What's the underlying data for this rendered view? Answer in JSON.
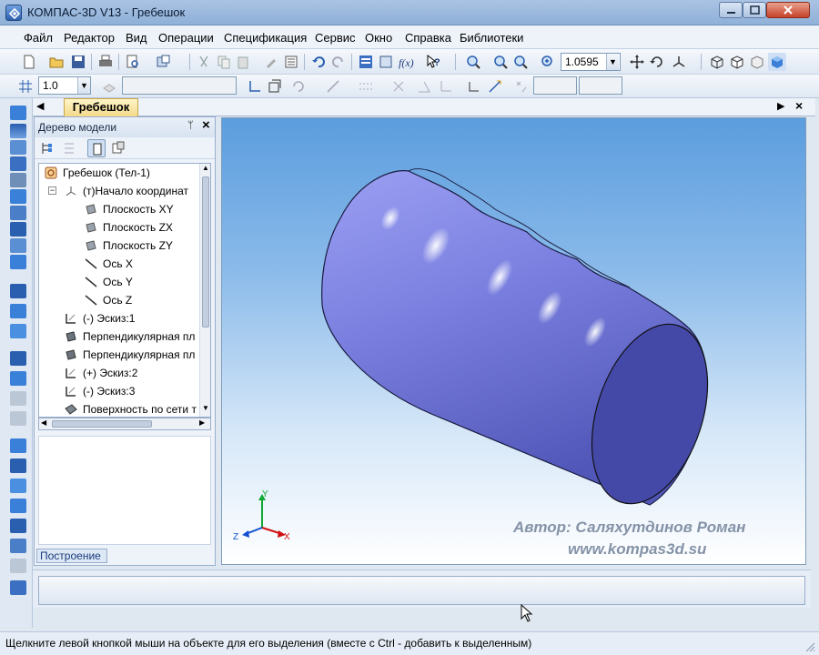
{
  "window": {
    "title": "КОМПАС-3D V13 - Гребешок"
  },
  "menu": [
    "Файл",
    "Редактор",
    "Вид",
    "Операции",
    "Спецификация",
    "Сервис",
    "Окно",
    "Справка",
    "Библиотеки"
  ],
  "toolbar": {
    "zoom_value": "1.0595",
    "step_value": "1.0"
  },
  "document_tab": "Гребешок",
  "panel": {
    "title": "Дерево модели",
    "bottom_tab": "Построение",
    "tree": [
      {
        "label": "Гребешок (Тел-1)",
        "icon": "part-icon"
      },
      {
        "label": "(т)Начало координат",
        "icon": "origin-icon"
      },
      {
        "label": "Плоскость XY",
        "icon": "plane-icon"
      },
      {
        "label": "Плоскость ZX",
        "icon": "plane-icon"
      },
      {
        "label": "Плоскость ZY",
        "icon": "plane-icon"
      },
      {
        "label": "Ось X",
        "icon": "axis-icon"
      },
      {
        "label": "Ось Y",
        "icon": "axis-icon"
      },
      {
        "label": "Ось Z",
        "icon": "axis-icon"
      },
      {
        "label": "(-) Эскиз:1",
        "icon": "sketch-icon"
      },
      {
        "label": "Перпендикулярная пл",
        "icon": "plane-icon"
      },
      {
        "label": "Перпендикулярная пл",
        "icon": "plane-icon"
      },
      {
        "label": "(+) Эскиз:2",
        "icon": "sketch-icon"
      },
      {
        "label": "(-) Эскиз:3",
        "icon": "sketch-icon"
      },
      {
        "label": "Поверхность по сети т",
        "icon": "surface-icon"
      }
    ]
  },
  "viewport": {
    "axes": {
      "x": "X",
      "y": "Y",
      "z": "Z"
    },
    "author_line1": "Автор: Саляхутдинов Роман",
    "author_line2": "www.kompas3d.su"
  },
  "status": "Щелкните левой кнопкой мыши на объекте для его выделения (вместе с Ctrl - добавить к выделенным)"
}
